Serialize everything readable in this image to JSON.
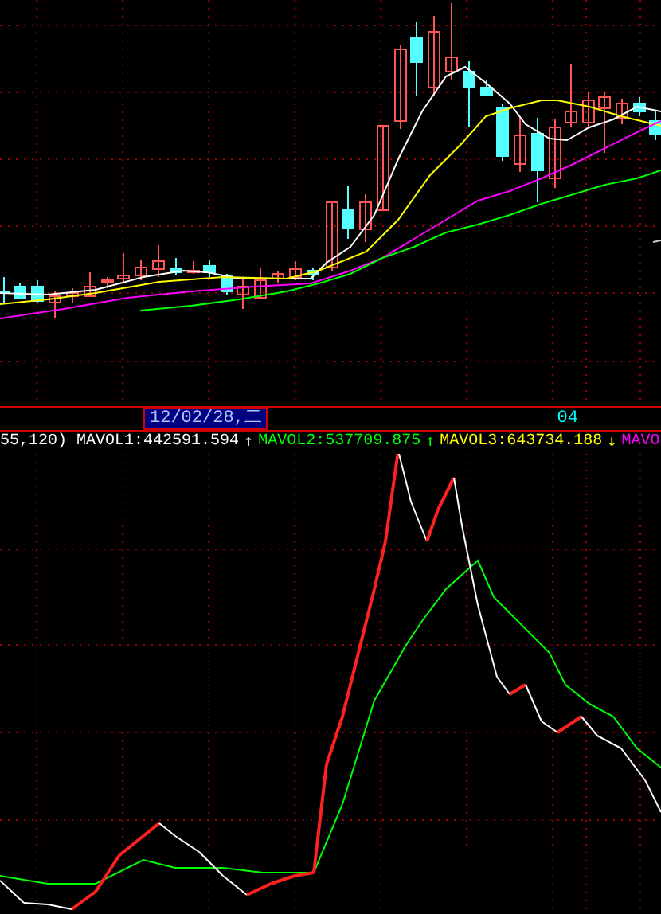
{
  "axis": {
    "date_cursor": "12/02/28,二",
    "tick": "04"
  },
  "legend": {
    "params": "55,120)",
    "items": [
      {
        "label": "MAVOL1:442591.594",
        "arrow": "↑",
        "color": "#ffffff"
      },
      {
        "label": "MAVOL2:537709.875",
        "arrow": "↑",
        "color": "#00ff00"
      },
      {
        "label": "MAVOL3:643734.188",
        "arrow": "↓",
        "color": "#ffff00"
      },
      {
        "label": "MAVO",
        "color": "#ff00ff"
      }
    ]
  }
}
